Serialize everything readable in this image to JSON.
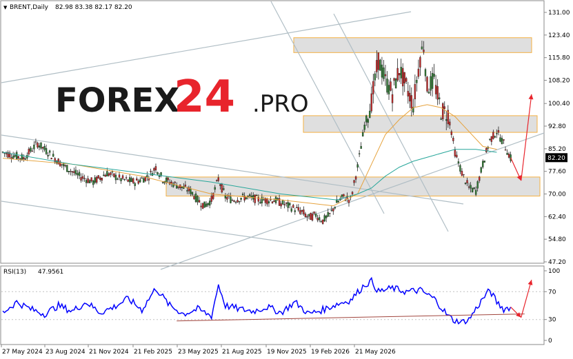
{
  "chart_data": [
    {
      "type": "candlestick",
      "symbol": "BRENT,Daily",
      "ohlc_label": "82.98 83.38 82.17 82.20",
      "last_price": "82.20",
      "y_ticks": [
        "131.00",
        "123.40",
        "115.80",
        "108.20",
        "100.40",
        "92.80",
        "85.20",
        "77.60",
        "70.00",
        "62.40",
        "54.80",
        "47.20"
      ],
      "ylim": [
        47.2,
        131.0
      ],
      "x_ticks": [
        "27 May 2024",
        "23 Aug 2024",
        "21 Nov 2024",
        "21 Feb 2025",
        "23 May 2025",
        "21 Aug 2025",
        "19 Nov 2025",
        "19 Feb 2026",
        "21 May 2026"
      ],
      "price_path": [
        [
          0,
          84
        ],
        [
          6,
          82
        ],
        [
          10,
          87
        ],
        [
          14,
          83
        ],
        [
          18,
          79
        ],
        [
          22,
          76
        ],
        [
          26,
          74
        ],
        [
          30,
          77
        ],
        [
          34,
          75
        ],
        [
          38,
          74
        ],
        [
          42,
          76
        ],
        [
          44,
          79
        ],
        [
          46,
          75
        ],
        [
          50,
          73
        ],
        [
          54,
          71
        ],
        [
          56,
          68
        ],
        [
          58,
          66
        ],
        [
          60,
          68
        ],
        [
          62,
          75
        ],
        [
          64,
          69
        ],
        [
          66,
          68
        ],
        [
          70,
          69
        ],
        [
          74,
          68
        ],
        [
          78,
          68
        ],
        [
          82,
          66
        ],
        [
          86,
          64
        ],
        [
          88,
          62
        ],
        [
          90,
          63
        ],
        [
          92,
          61
        ],
        [
          94,
          63
        ],
        [
          96,
          67
        ],
        [
          98,
          69
        ],
        [
          100,
          68
        ],
        [
          102,
          79
        ],
        [
          104,
          93
        ],
        [
          106,
          101
        ],
        [
          108,
          115
        ],
        [
          110,
          108
        ],
        [
          112,
          104
        ],
        [
          114,
          112
        ],
        [
          116,
          106
        ],
        [
          118,
          100
        ],
        [
          120,
          116
        ],
        [
          121,
          120
        ],
        [
          122,
          106
        ],
        [
          124,
          108
        ],
        [
          126,
          98
        ],
        [
          128,
          97
        ],
        [
          129,
          91
        ],
        [
          130,
          84
        ],
        [
          132,
          77
        ],
        [
          134,
          72
        ],
        [
          136,
          71
        ],
        [
          138,
          80
        ],
        [
          140,
          88
        ],
        [
          142,
          91
        ],
        [
          144,
          87
        ],
        [
          146,
          82
        ]
      ],
      "ma_fast": [
        [
          0,
          82
        ],
        [
          20,
          80
        ],
        [
          40,
          76
        ],
        [
          60,
          70
        ],
        [
          80,
          68
        ],
        [
          95,
          66
        ],
        [
          102,
          70
        ],
        [
          106,
          80
        ],
        [
          110,
          90
        ],
        [
          114,
          95
        ],
        [
          118,
          99
        ],
        [
          122,
          100
        ],
        [
          126,
          99
        ],
        [
          130,
          96
        ],
        [
          134,
          91
        ],
        [
          138,
          86
        ],
        [
          142,
          85
        ]
      ],
      "ma_slow": [
        [
          0,
          84
        ],
        [
          20,
          80
        ],
        [
          40,
          77
        ],
        [
          60,
          74
        ],
        [
          80,
          70
        ],
        [
          96,
          68
        ],
        [
          102,
          70
        ],
        [
          106,
          72
        ],
        [
          110,
          76
        ],
        [
          114,
          79
        ],
        [
          118,
          81
        ],
        [
          124,
          83
        ],
        [
          130,
          85
        ],
        [
          136,
          85
        ],
        [
          142,
          84
        ]
      ],
      "zones": [
        [
          117.5,
          122.5
        ],
        [
          90.7,
          96.3
        ],
        [
          69.3,
          75.7
        ]
      ],
      "forecast_path": [
        [
          146,
          82.2
        ],
        [
          149,
          74.5
        ],
        [
          152,
          103.5
        ]
      ],
      "forecast_color": "#e8242c",
      "zone_border_color": "#f5b041",
      "watermark": {
        "brand": "FOREX",
        "number": "24",
        "suffix": ".PRO",
        "brand_color": "#1a1a1a",
        "accent_color": "#e8242c"
      }
    },
    {
      "type": "line",
      "indicator": "RSI(13)",
      "value_label": "47.9561",
      "y_ticks": [
        "100",
        "70",
        "30",
        "0"
      ],
      "ylim": [
        0,
        100
      ],
      "series_color": "#0000ff",
      "rsi_path": [
        [
          0,
          40
        ],
        [
          4,
          55
        ],
        [
          8,
          45
        ],
        [
          12,
          38
        ],
        [
          16,
          50
        ],
        [
          20,
          42
        ],
        [
          24,
          55
        ],
        [
          28,
          40
        ],
        [
          32,
          48
        ],
        [
          36,
          60
        ],
        [
          40,
          44
        ],
        [
          44,
          75
        ],
        [
          48,
          50
        ],
        [
          52,
          38
        ],
        [
          56,
          45
        ],
        [
          60,
          35
        ],
        [
          62,
          80
        ],
        [
          64,
          50
        ],
        [
          68,
          45
        ],
        [
          72,
          42
        ],
        [
          76,
          48
        ],
        [
          80,
          40
        ],
        [
          84,
          55
        ],
        [
          88,
          38
        ],
        [
          92,
          44
        ],
        [
          96,
          52
        ],
        [
          100,
          58
        ],
        [
          104,
          80
        ],
        [
          106,
          85
        ],
        [
          108,
          70
        ],
        [
          112,
          75
        ],
        [
          116,
          70
        ],
        [
          120,
          72
        ],
        [
          124,
          60
        ],
        [
          126,
          48
        ],
        [
          128,
          35
        ],
        [
          130,
          28
        ],
        [
          132,
          26
        ],
        [
          134,
          30
        ],
        [
          136,
          45
        ],
        [
          138,
          60
        ],
        [
          140,
          72
        ],
        [
          142,
          55
        ],
        [
          144,
          45
        ],
        [
          146,
          48
        ]
      ],
      "forecast_path": [
        [
          146,
          48
        ],
        [
          149,
          33
        ],
        [
          152,
          87
        ]
      ],
      "trend_line": [
        [
          50,
          28
        ],
        [
          150,
          38
        ]
      ]
    }
  ]
}
